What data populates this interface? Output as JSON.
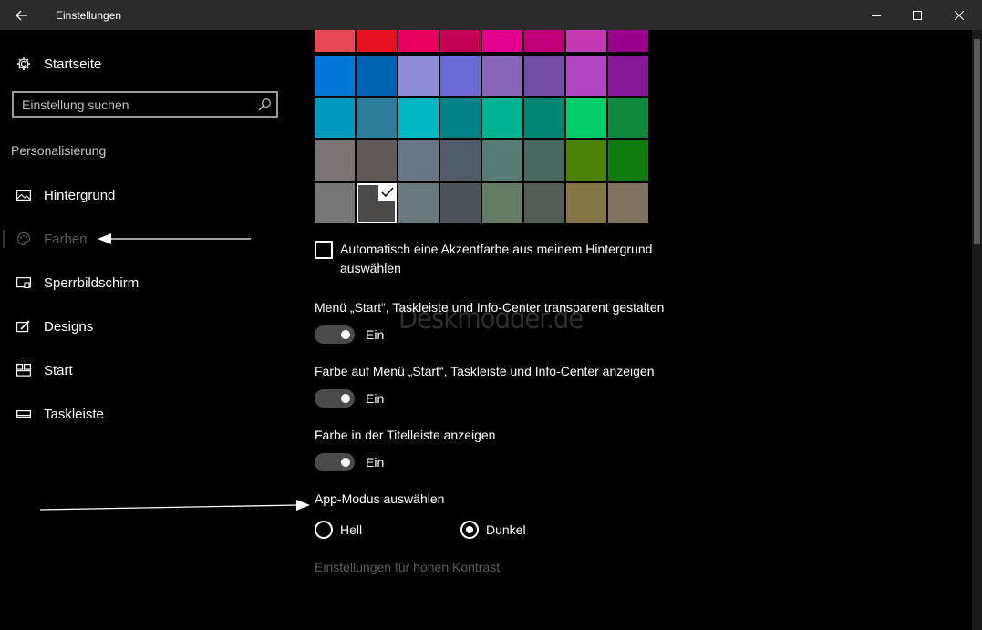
{
  "window": {
    "title": "Einstellungen"
  },
  "sidebar": {
    "home_label": "Startseite",
    "search_placeholder": "Einstellung suchen",
    "section_title": "Personalisierung",
    "items": [
      {
        "label": "Hintergrund",
        "icon": "image-icon"
      },
      {
        "label": "Farben",
        "icon": "palette-icon"
      },
      {
        "label": "Sperrbildschirm",
        "icon": "lockscreen-icon"
      },
      {
        "label": "Designs",
        "icon": "designs-icon"
      },
      {
        "label": "Start",
        "icon": "start-icon"
      },
      {
        "label": "Taskleiste",
        "icon": "taskbar-icon"
      }
    ]
  },
  "colors": {
    "rows": [
      [
        "#e74856",
        "#e81123",
        "#ea005e",
        "#c30052",
        "#e3008c",
        "#bf0077",
        "#c239b3",
        "#9a0089"
      ],
      [
        "#0078d7",
        "#0063b1",
        "#8e8cd8",
        "#6b69d6",
        "#8764b8",
        "#744da9",
        "#b146c2",
        "#881798"
      ],
      [
        "#0099bc",
        "#2d7d9a",
        "#00b7c3",
        "#038387",
        "#00b294",
        "#018574",
        "#00cc6a",
        "#10893e"
      ],
      [
        "#7a7574",
        "#5d5a58",
        "#68768a",
        "#515c6b",
        "#567c73",
        "#486860",
        "#498205",
        "#107c10"
      ],
      [
        "#767676",
        "#4c4a48",
        "#69797e",
        "#4a5459",
        "#647c64",
        "#525e54",
        "#847545",
        "#7e735f"
      ]
    ],
    "selected": "#4c4a48"
  },
  "auto_accent": {
    "label": "Automatisch eine Akzentfarbe aus meinem Hintergrund auswählen",
    "checked": false
  },
  "toggles": [
    {
      "label": "Menü „Start“, Taskleiste und Info-Center transparent gestalten",
      "state": "Ein"
    },
    {
      "label": "Farbe auf Menü „Start“, Taskleiste und Info-Center anzeigen",
      "state": "Ein"
    },
    {
      "label": "Farbe in der Titelleiste anzeigen",
      "state": "Ein"
    }
  ],
  "app_mode": {
    "label": "App-Modus auswählen",
    "options": [
      "Hell",
      "Dunkel"
    ],
    "selected": "Dunkel"
  },
  "high_contrast_link": "Einstellungen für hohen Kontrast",
  "watermark": "Deskmodder.de"
}
